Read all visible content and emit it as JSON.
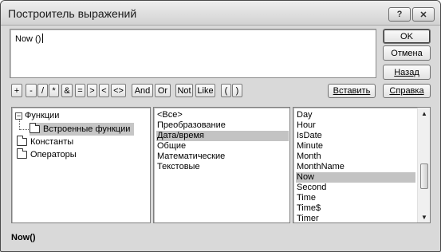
{
  "window": {
    "title": "Построитель выражений",
    "help_glyph": "?",
    "close_glyph": "✕"
  },
  "expression": {
    "value": "Now ()"
  },
  "buttons": {
    "ok": "OK",
    "cancel": "Отмена",
    "back": "Назад",
    "insert": "Вставить",
    "help": "Справка"
  },
  "operators": [
    "+",
    "-",
    "/",
    "*",
    "&",
    "=",
    ">",
    "<",
    "<>",
    "And",
    "Or",
    "Not",
    "Like",
    "(",
    ")"
  ],
  "tree": {
    "items": [
      {
        "label": "Функции"
      },
      {
        "label": "Встроенные функции"
      },
      {
        "label": "Константы"
      },
      {
        "label": "Операторы"
      }
    ]
  },
  "categories": {
    "items": [
      "<Все>",
      "Преобразование",
      "Дата/время",
      "Общие",
      "Математические",
      "Текстовые"
    ],
    "selected": "Дата/время"
  },
  "functions": {
    "items": [
      "Day",
      "Hour",
      "IsDate",
      "Minute",
      "Month",
      "MonthName",
      "Now",
      "Second",
      "Time",
      "Time$",
      "Timer"
    ],
    "selected": "Now"
  },
  "status": {
    "text": "Now()"
  },
  "colors": {
    "selection": "#c3c3c3",
    "dialog": "#d9d9d9"
  }
}
